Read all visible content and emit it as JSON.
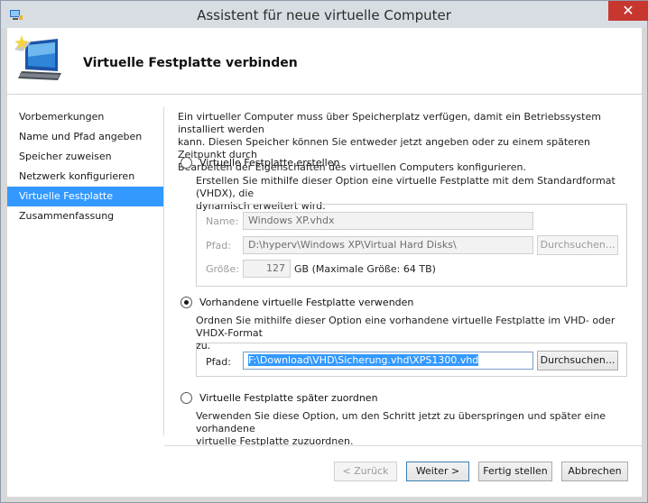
{
  "window": {
    "title": "Assistent für neue virtuelle Computer",
    "close_label": "✕"
  },
  "header": {
    "page_title": "Virtuelle Festplatte verbinden"
  },
  "nav": {
    "items": [
      {
        "label": "Vorbemerkungen",
        "active": false
      },
      {
        "label": "Name und Pfad angeben",
        "active": false
      },
      {
        "label": "Speicher zuweisen",
        "active": false
      },
      {
        "label": "Netzwerk konfigurieren",
        "active": false
      },
      {
        "label": "Virtuelle Festplatte verbinden",
        "active": true
      },
      {
        "label": "Zusammenfassung",
        "active": false
      }
    ]
  },
  "intro": {
    "line1": "Ein virtueller Computer muss über Speicherplatz verfügen, damit ein Betriebssystem installiert werden",
    "line2": "kann. Diesen Speicher können Sie entweder jetzt angeben oder zu einem späteren Zeitpunkt durch",
    "line3": "Bearbeiten der Eigenschaften des virtuellen Computers konfigurieren."
  },
  "option_create": {
    "label": "Virtuelle Festplatte erstellen",
    "selected": false,
    "desc1": "Erstellen Sie mithilfe dieser Option eine virtuelle Festplatte mit dem Standardformat (VHDX), die",
    "desc2": "dynamisch erweitert wird.",
    "name_label": "Name:",
    "name_value": "Windows XP.vhdx",
    "path_label": "Pfad:",
    "path_value": "D:\\hyperv\\Windows XP\\Virtual Hard Disks\\",
    "browse_label": "Durchsuchen...",
    "size_label": "Größe:",
    "size_value": "127",
    "size_unit": "GB (Maximale Größe: 64 TB)"
  },
  "option_existing": {
    "label": "Vorhandene virtuelle Festplatte verwenden",
    "selected": true,
    "desc1": "Ordnen Sie mithilfe dieser Option eine vorhandene virtuelle Festplatte im VHD- oder VHDX-Format",
    "desc2": "zu.",
    "path_label": "Pfad:",
    "path_value": "F:\\Download\\VHD\\Sicherung.vhd\\XPS1300.vhd",
    "browse_label": "Durchsuchen..."
  },
  "option_later": {
    "label": "Virtuelle Festplatte später zuordnen",
    "selected": false,
    "desc1": "Verwenden Sie diese Option, um den Schritt jetzt zu überspringen und später eine vorhandene",
    "desc2": "virtuelle Festplatte zuzuordnen."
  },
  "footer": {
    "back_label": "< Zurück",
    "next_label": "Weiter >",
    "finish_label": "Fertig stellen",
    "cancel_label": "Abbrechen"
  },
  "colors": {
    "accent": "#3399ff",
    "close": "#c7372f"
  }
}
